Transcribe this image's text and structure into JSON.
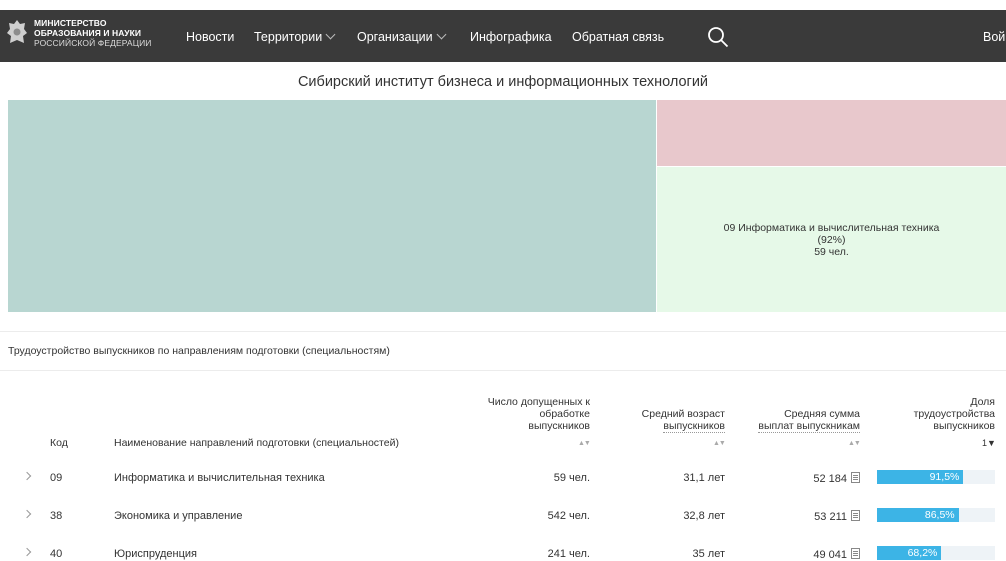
{
  "header": {
    "logo_line1": "МИНИСТЕРСТВО",
    "logo_line2": "ОБРАЗОВАНИЯ И НАУКИ",
    "logo_line3": "РОССИЙСКОЙ ФЕДЕРАЦИИ",
    "nav": [
      {
        "label": "Новости",
        "has_dropdown": false
      },
      {
        "label": "Территории",
        "has_dropdown": true
      },
      {
        "label": "Организации",
        "has_dropdown": true
      },
      {
        "label": "Инфографика",
        "has_dropdown": false
      },
      {
        "label": "Обратная связь",
        "has_dropdown": false
      }
    ],
    "login_label": "Вой",
    "colors": {
      "bar": "#3a3a3a",
      "text": "#ffffff"
    }
  },
  "institution_title": "Сибирский институт бизнеса и информационных технологий",
  "treemap": {
    "tiles": [
      {
        "color": "#b8d6d1"
      },
      {
        "color": "#e8c8cc"
      },
      {
        "color": "#e6f9e8",
        "label": "09 Информатика и вычислительная техника",
        "percent": "(92%)",
        "count": "59 чел."
      }
    ]
  },
  "section_title": "Трудоустройство выпускников по направлениям подготовки (специальностям)",
  "table": {
    "headers": {
      "code": "Код",
      "name": "Наименование направлений подготовки (специальностей)",
      "admitted_l1": "Число допущенных к",
      "admitted_l2": "обработке",
      "admitted_l3": "выпускников",
      "age_l1": "Средний возраст",
      "age_l2": "выпускников",
      "pay_l1": "Средняя сумма",
      "pay_l2": "выплат выпускникам",
      "share_l1": "Доля",
      "share_l2": "трудоустройства",
      "share_l3": "выпускников",
      "sort_icon": "▲▼",
      "active_sort": "1▼"
    },
    "rows": [
      {
        "code": "09",
        "name": "Информатика и вычислительная техника",
        "admitted": "59 чел.",
        "age": "31,1 лет",
        "pay": "52 184",
        "share": 91.5,
        "share_label": "91,5%"
      },
      {
        "code": "38",
        "name": "Экономика и управление",
        "admitted": "542 чел.",
        "age": "32,8 лет",
        "pay": "53 211",
        "share": 86.5,
        "share_label": "86,5%"
      },
      {
        "code": "40",
        "name": "Юриспруденция",
        "admitted": "241 чел.",
        "age": "35 лет",
        "pay": "49 041",
        "share": 68.2,
        "share_label": "68,2%"
      }
    ],
    "bar_color": "#3cb4e6"
  }
}
